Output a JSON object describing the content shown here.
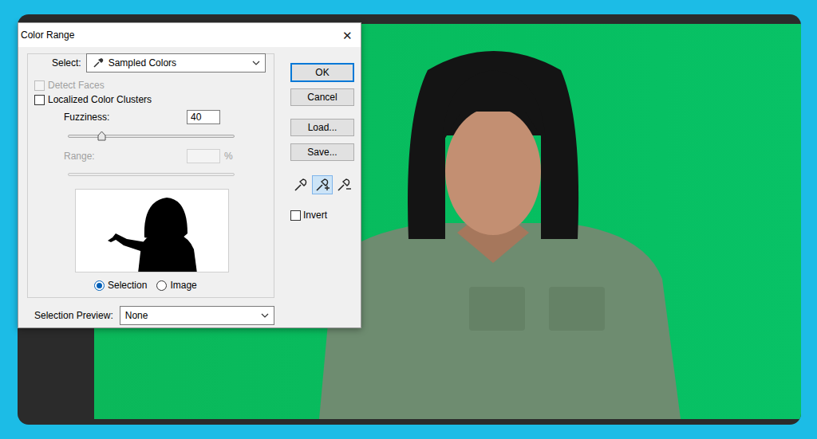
{
  "dialog": {
    "title": "Color Range",
    "close": "✕"
  },
  "select": {
    "label": "Select:",
    "value": "Sampled Colors"
  },
  "options": [
    {
      "label": "Detect Faces",
      "checked": false,
      "disabled": true
    },
    {
      "label": "Localized Color Clusters",
      "checked": false,
      "disabled": false
    }
  ],
  "fuzziness": {
    "label": "Fuzziness:",
    "value": "40",
    "level": 0.2
  },
  "range": {
    "label": "Range:",
    "value": "",
    "unit": "%",
    "disabled": true
  },
  "preview_modes": [
    {
      "label": "Selection",
      "selected": true
    },
    {
      "label": "Image",
      "selected": false
    }
  ],
  "selection_preview": {
    "label": "Selection Preview:",
    "value": "None"
  },
  "buttons": [
    {
      "label": "OK",
      "default": true
    },
    {
      "label": "Cancel",
      "default": false
    },
    {
      "label": "Load...",
      "default": false
    },
    {
      "label": "Save...",
      "default": false
    }
  ],
  "eyedroppers": [
    {
      "kind": "sample",
      "selected": false
    },
    {
      "kind": "add",
      "selected": true
    },
    {
      "kind": "subtract",
      "selected": false
    }
  ],
  "invert": {
    "label": "Invert",
    "checked": false
  }
}
